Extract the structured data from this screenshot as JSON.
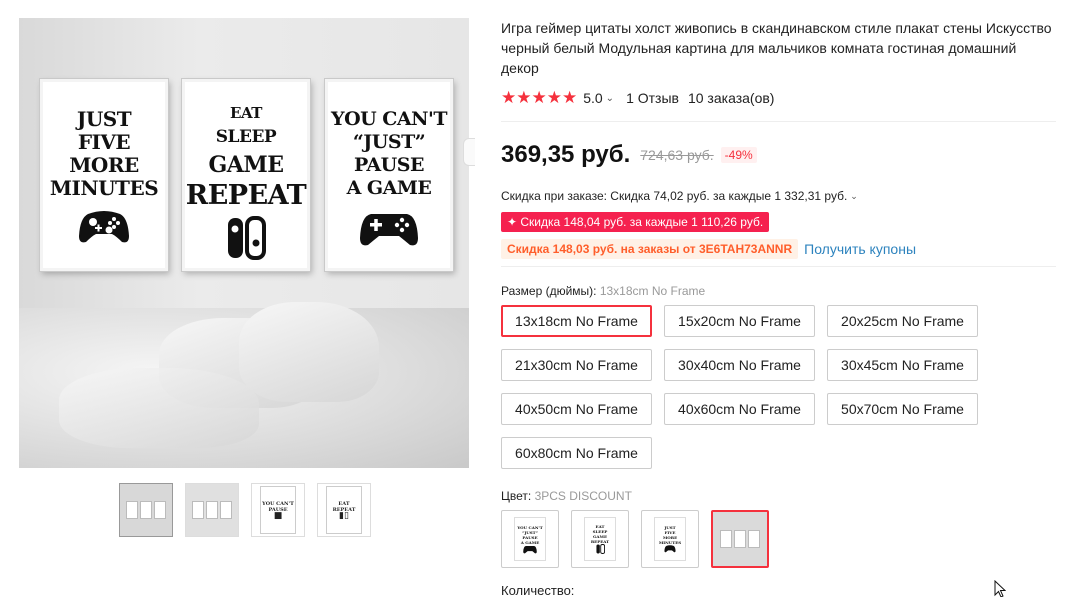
{
  "product": {
    "title": "Игра геймер цитаты холст живопись в скандинавском стиле плакат стены Искусство черный белый Модульная картина для мальчиков комната гостиная домашний декор",
    "rating_stars": "★★★★★",
    "rating_value": "5.0",
    "reviews": "1 Отзыв",
    "orders": "10 заказа(ов)"
  },
  "gallery": {
    "posters": [
      [
        "JUST",
        "FIVE",
        "MORE",
        "MINUTES"
      ],
      [
        "EAT",
        "SLEEP",
        "GAME",
        "REPEAT"
      ],
      [
        "YOU CAN'T",
        "“JUST”",
        "PAUSE",
        "A GAME"
      ]
    ],
    "thumbnail_count": 4
  },
  "pricing": {
    "price": "369,35 руб.",
    "old_price": "724,63 руб.",
    "discount_percent": "-49%",
    "order_discount": "Скидка при заказе: Скидка 74,02 руб. за каждые 1 332,31 руб.",
    "promo_badge": "✦ Скидка 148,04 руб. за каждые 1 110,26 руб.",
    "coupon_tag": "Скидка 148,03 руб. на заказы от 3E6TAH73ANNR",
    "coupon_link": "Получить купоны"
  },
  "size": {
    "label": "Размер (дюймы): ",
    "selected": "13x18cm No Frame",
    "options": [
      "13x18cm No Frame",
      "15x20cm No Frame",
      "20x25cm No Frame",
      "21x30cm No Frame",
      "30x40cm No Frame",
      "30x45cm No Frame",
      "40x50cm No Frame",
      "40x60cm No Frame",
      "50x70cm No Frame",
      "60x80cm No Frame"
    ]
  },
  "color": {
    "label": "Цвет: ",
    "selected": "3PCS DISCOUNT"
  },
  "quantity": {
    "label": "Количество:"
  },
  "colors": {
    "accent": "#f5313d",
    "promo": "#f5214f",
    "coupon_text": "#ff5e2b",
    "link": "#2d83be"
  }
}
